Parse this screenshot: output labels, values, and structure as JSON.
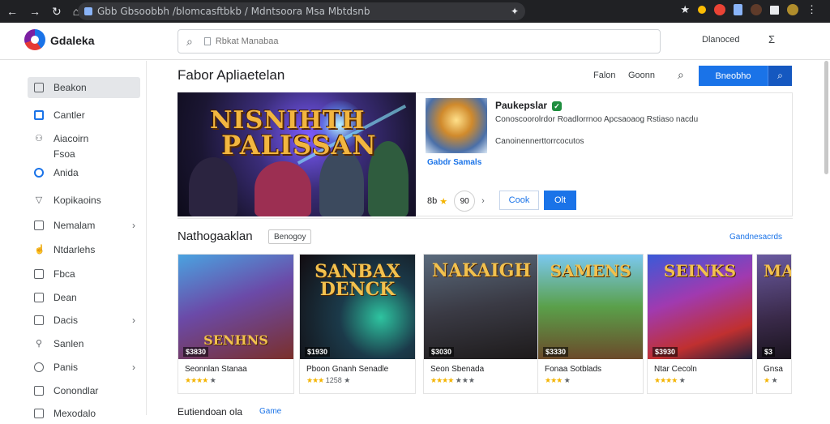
{
  "browser": {
    "address_text": "Gbb Gbsoobbh ​/blomcasftbkb ​/ Mdntsoora Msa Mbtdsnb",
    "icons": [
      "back-icon",
      "forward-icon",
      "reload-icon",
      "home-icon",
      "star-icon"
    ]
  },
  "header": {
    "app_title": "Gdaleka",
    "search_placeholder": "Rbkat Manabaa",
    "user_name": "Dlanoced",
    "menu_glyph": "Σ"
  },
  "sidebar": {
    "items": [
      {
        "label": "Beakon",
        "icon": "box-icon",
        "active": true,
        "chevron": false
      },
      {
        "label": "Cantler",
        "icon": "app-icon",
        "active": false,
        "chevron": false
      },
      {
        "label": "Aiacoirn",
        "icon": "puzzle-icon",
        "active": false,
        "chevron": false
      },
      {
        "label": "Fsoa",
        "icon": "",
        "active": false,
        "chevron": false
      },
      {
        "label": "Anida",
        "icon": "circle-icon",
        "active": false,
        "chevron": false
      },
      {
        "label": "Kopikaoins",
        "icon": "shield-icon",
        "active": false,
        "chevron": false
      },
      {
        "label": "Nemalam",
        "icon": "grid-icon",
        "active": false,
        "chevron": true
      },
      {
        "label": "Ntdarlehs",
        "icon": "thumb-icon",
        "active": false,
        "chevron": false
      },
      {
        "label": "Fbca",
        "icon": "square-icon",
        "active": false,
        "chevron": false
      },
      {
        "label": "Dean",
        "icon": "square-icon",
        "active": false,
        "chevron": false
      },
      {
        "label": "Dacis",
        "icon": "doc-icon",
        "active": false,
        "chevron": true
      },
      {
        "label": "Sanlen",
        "icon": "pin-icon",
        "active": false,
        "chevron": false
      },
      {
        "label": "Panis",
        "icon": "circle-icon",
        "active": false,
        "chevron": true
      },
      {
        "label": "Conondlar",
        "icon": "doc-icon",
        "active": false,
        "chevron": false
      },
      {
        "label": "Mexodalo",
        "icon": "square-icon",
        "active": false,
        "chevron": false
      }
    ]
  },
  "main": {
    "section_title": "Fabor Apliaetelan",
    "top_links": [
      "Falon",
      "Goonn"
    ],
    "primary_button": "Bneobho",
    "hero": {
      "title_line1": "NISNIHTH",
      "title_line2": "PALISSAN"
    },
    "detail": {
      "title": "Paukepslar",
      "desc": "Conoscoorolrdor Roadlorrnoo Apcsaoaog Rstiaso nacdu",
      "sub": "Canoinennerttorrcocutos",
      "thumb_caption": "Gabdr Samals",
      "rating_value": "8b",
      "rating_circle": "90",
      "outline_button": "Cook",
      "fill_button": "Olt"
    },
    "row2": {
      "title": "Nathogaaklan",
      "filter_chip": "Benogoy",
      "see_all": "Gandnesacrds",
      "cards": [
        {
          "art_title": "SENHNS",
          "price": "$3830",
          "name": "Seonnlan Stanaa",
          "stars": "★★★★",
          "count": "★"
        },
        {
          "art_title": "SANBAX DENCK",
          "price": "$1930",
          "name": "Pboon Gnanh Senadle",
          "stars": "★★★",
          "count": "1258 ★"
        },
        {
          "art_title": "NAKAIGH",
          "price": "$3030",
          "name": "Seon Sbenada",
          "stars": "★★★★",
          "count": "★★★"
        },
        {
          "art_title": "SAMENS",
          "price": "$3330",
          "name": "Fonaa Sotblads",
          "stars": "★★★",
          "count": "★"
        },
        {
          "art_title": "SEINKS",
          "price": "$3930",
          "name": "Ntar Cecoln",
          "stars": "★★★★",
          "count": "★"
        },
        {
          "art_title": "MA",
          "price": "$3",
          "name": "Gnsa",
          "stars": "★",
          "count": "★"
        }
      ]
    },
    "bottom_title": "Eutiendoan ola",
    "bottom_link": "Game"
  },
  "colors": {
    "accent": "#1a73e8",
    "chrome": "#202124",
    "star": "#f4b400"
  }
}
